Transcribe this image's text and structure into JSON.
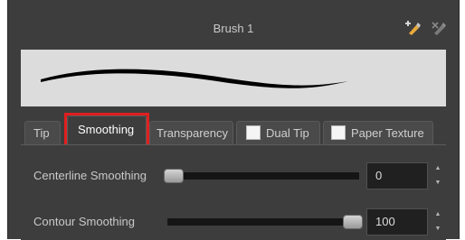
{
  "header": {
    "title": "Brush 1",
    "icons": [
      "add-brush-icon",
      "delete-brush-icon"
    ]
  },
  "tabs": [
    {
      "label": "Tip",
      "active": false,
      "checkbox": false
    },
    {
      "label": "Smoothing",
      "active": true,
      "checkbox": false
    },
    {
      "label": "Transparency",
      "active": false,
      "checkbox": false
    },
    {
      "label": "Dual Tip",
      "active": false,
      "checkbox": true,
      "checked": false
    },
    {
      "label": "Paper Texture",
      "active": false,
      "checkbox": true,
      "checked": false
    }
  ],
  "smoothing": {
    "centerline": {
      "label": "Centerline Smoothing",
      "value": "0",
      "slider_fraction": 0.0
    },
    "contour": {
      "label": "Contour Smoothing",
      "value": "100",
      "slider_fraction": 1.0
    }
  },
  "colors": {
    "highlight": "#e01f1f",
    "panel": "#3d3d3d",
    "preview_bg": "#dcdcdc"
  }
}
